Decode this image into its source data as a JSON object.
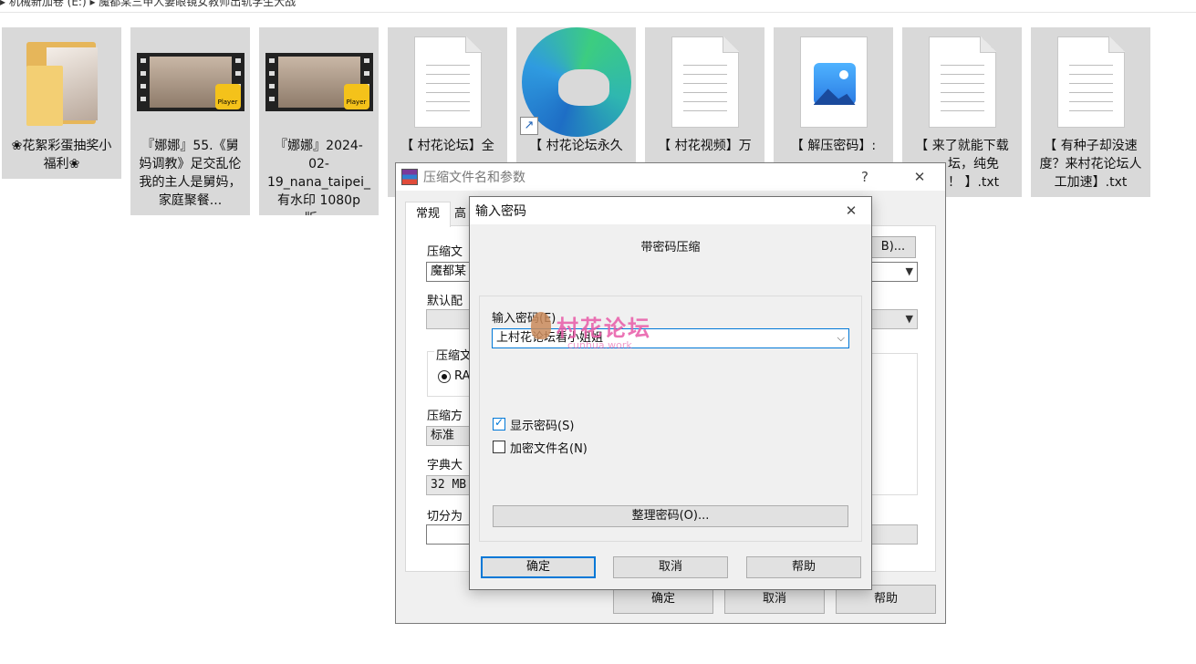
{
  "breadcrumb": "▸  机械新加卷 (E:)  ▸  魔都某三甲人妻眼镜女教师出轨学生大战",
  "files": [
    {
      "label": "❀花絮彩蛋抽奖小福利❀",
      "icon": "folder-icon"
    },
    {
      "label": "『娜娜』55.《舅妈调教》足交乱伦 我的主人是舅妈，家庭聚餐...",
      "icon": "video-icon"
    },
    {
      "label": "『娜娜』2024-02-19_nana_taipei_有水印 1080p版....",
      "icon": "video-icon"
    },
    {
      "label": "【 村花论坛】全",
      "icon": "text-file-icon"
    },
    {
      "label": "【 村花论坛永久",
      "icon": "edge-shortcut-icon"
    },
    {
      "label": "【 村花视频】万",
      "icon": "text-file-icon"
    },
    {
      "label": "【 解压密码】:",
      "icon": "image-file-icon"
    },
    {
      "label": "【 来了就能下载",
      "label2": "坛，纯免",
      "label3": "！ 】.txt",
      "icon": "text-file-icon"
    },
    {
      "label": "【 有种子却没速度？来村花论坛人工加速】.txt",
      "icon": "text-file-icon"
    }
  ],
  "badge": {
    "player": "Player"
  },
  "archive_dialog": {
    "title": "压缩文件名和参数",
    "help_glyph": "?",
    "close_glyph": "✕",
    "tabs": [
      "常规",
      "高"
    ],
    "archive_name_label": "压缩文",
    "archive_name_value": "魔都某",
    "browse_label": "B)...",
    "profile_label": "默认配",
    "format_group_label": "压缩文",
    "format_rar": "RA",
    "method_label": "压缩方",
    "method_value": "标准",
    "dict_label": "字典大",
    "dict_value": "32 MB",
    "split_label": "切分为",
    "ok": "确定",
    "cancel": "取消",
    "help": "帮助"
  },
  "password_dialog": {
    "title": "输入密码",
    "close_glyph": "✕",
    "heading": "带密码压缩",
    "enter_label": "输入密码(E)",
    "password_value": "上村花论坛看小姐姐",
    "show_password": "显示密码(S)",
    "show_password_checked": true,
    "encrypt_names": "加密文件名(N)",
    "encrypt_names_checked": false,
    "organize": "整理密码(O)...",
    "ok": "确定",
    "cancel": "取消",
    "help": "帮助"
  },
  "watermark": {
    "text": "村花论坛",
    "sub": "cunhua.work"
  },
  "colors": {
    "accent": "#0078d7",
    "tile_bg": "#d9d9d9",
    "watermark": "#e85aa8"
  }
}
